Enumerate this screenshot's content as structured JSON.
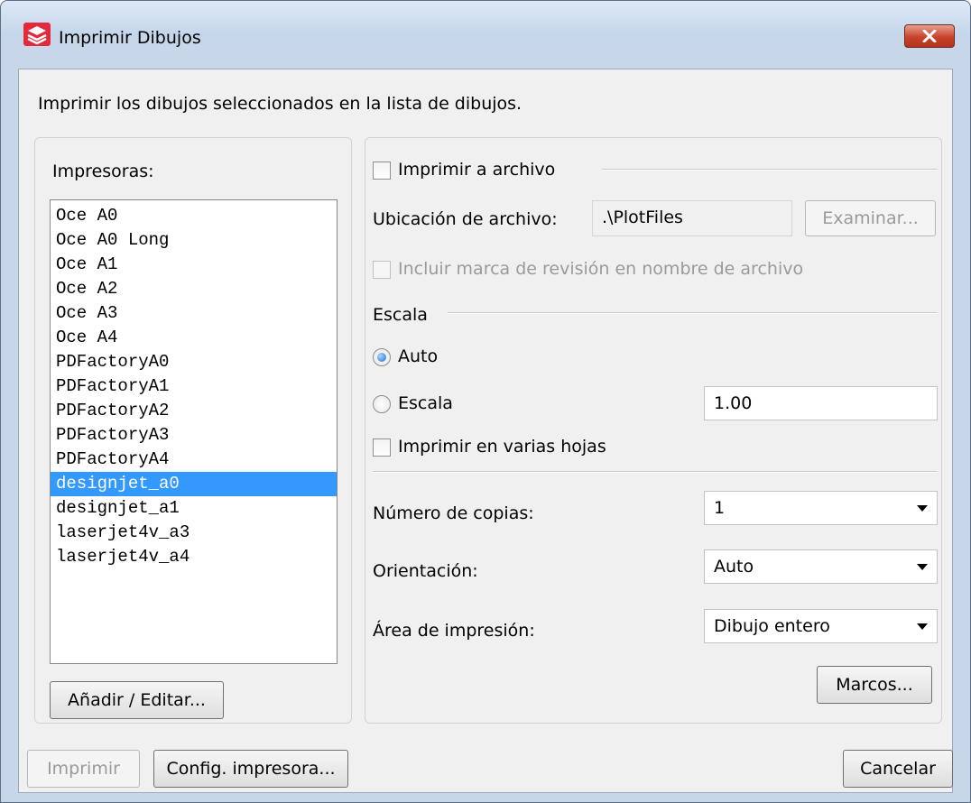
{
  "window": {
    "title": "Imprimir Dibujos",
    "close_icon": "close-icon"
  },
  "description": "Imprimir los dibujos seleccionados en la lista de dibujos.",
  "printers": {
    "label": "Impresoras:",
    "items": [
      "Oce A0",
      "Oce A0 Long",
      "Oce A1",
      "Oce A2",
      "Oce A3",
      "Oce A4",
      "PDFactoryA0",
      "PDFactoryA1",
      "PDFactoryA2",
      "PDFactoryA3",
      "PDFactoryA4",
      "designjet_a0",
      "designjet_a1",
      "laserjet4v_a3",
      "laserjet4v_a4"
    ],
    "selected": "designjet_a0",
    "add_edit_label": "Añadir / Editar..."
  },
  "print_to_file": {
    "checkbox_label": "Imprimir a archivo",
    "checked": false,
    "location_label": "Ubicación de archivo:",
    "location_value": ".\\PlotFiles",
    "browse_label": "Examinar...",
    "revision_label": "Incluir marca de revisión en nombre de archivo"
  },
  "scale": {
    "section_label": "Escala",
    "auto_label": "Auto",
    "scale_label": "Escala",
    "selected": "auto",
    "scale_value": "1.00",
    "multi_sheet_label": "Imprimir en varias hojas"
  },
  "options": {
    "copies_label": "Número de copias:",
    "copies_value": "1",
    "orientation_label": "Orientación:",
    "orientation_value": "Auto",
    "area_label": "Área de impresión:",
    "area_value": "Dibujo entero",
    "frames_label": "Marcos..."
  },
  "footer": {
    "print_label": "Imprimir",
    "config_label": "Config. impresora...",
    "cancel_label": "Cancelar"
  },
  "colors": {
    "selection": "#3399ff",
    "window_frame": "#c7d6e8",
    "close_button": "#c8422b"
  }
}
